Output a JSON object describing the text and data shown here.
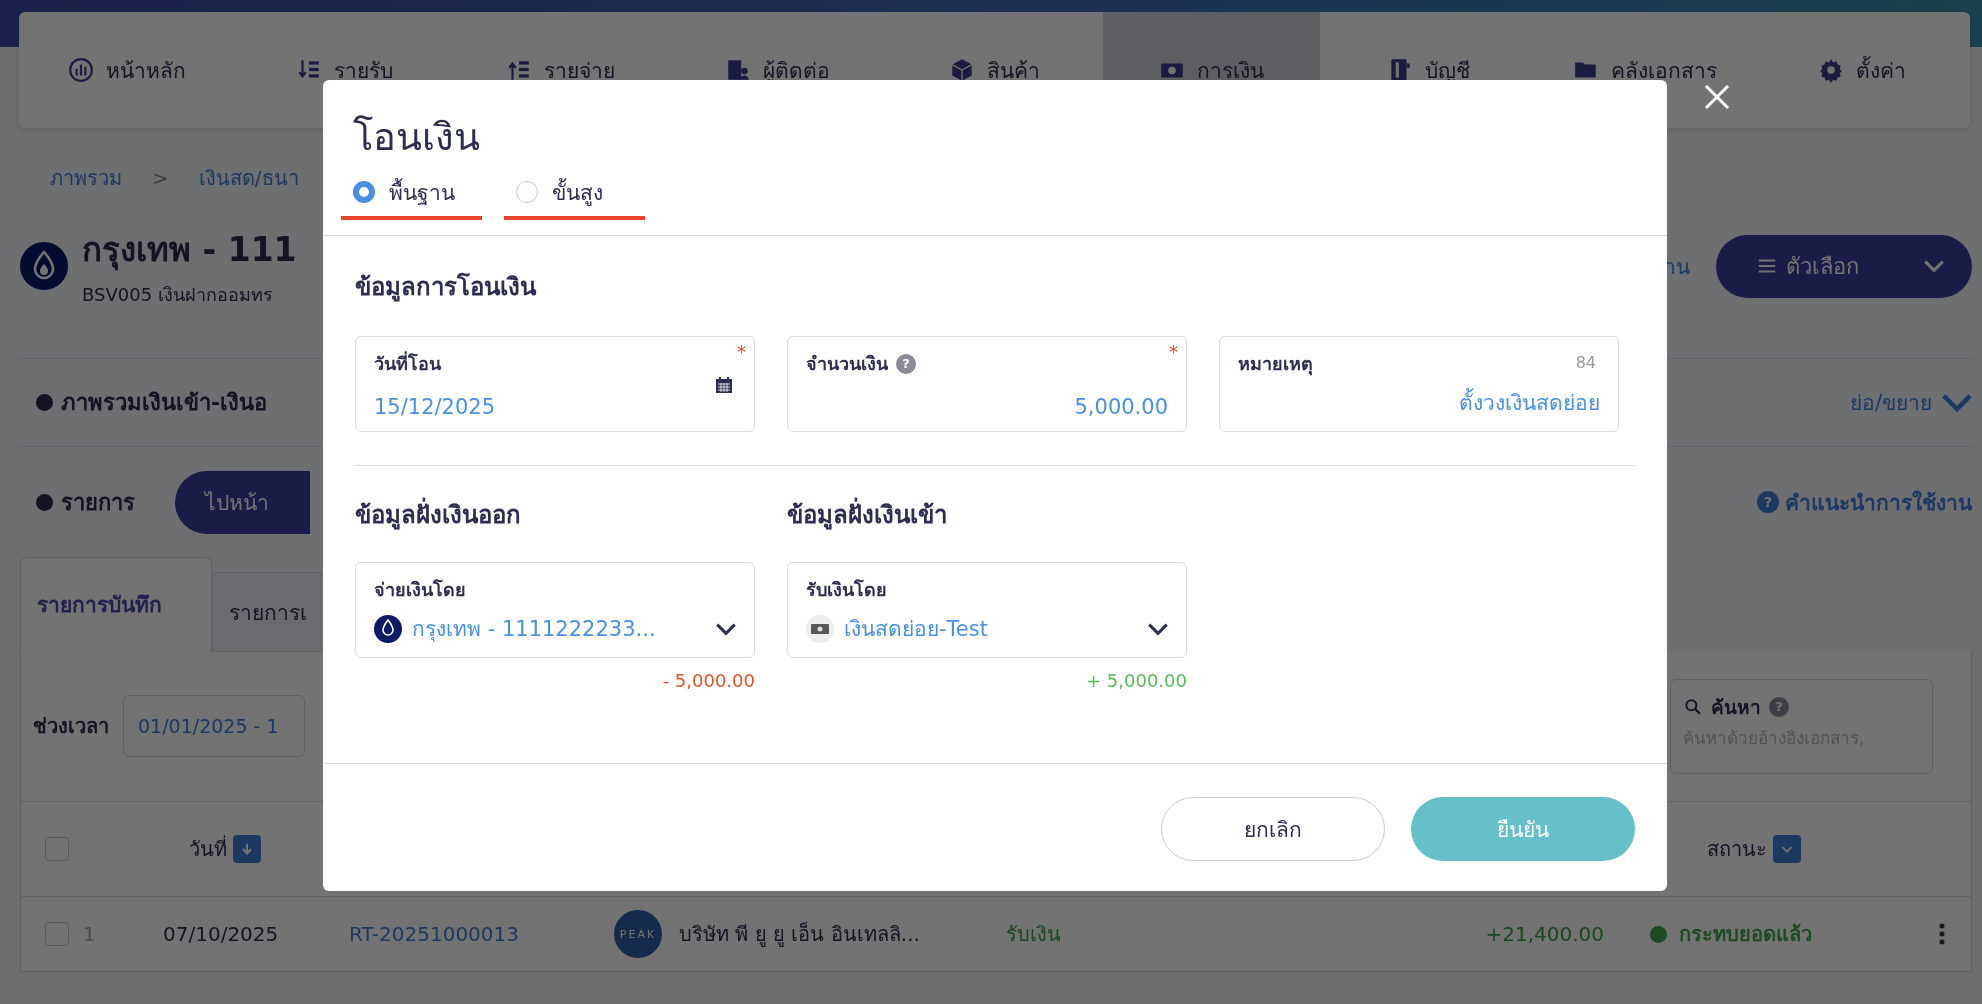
{
  "nav": [
    {
      "label": "หน้าหลัก",
      "selected": false
    },
    {
      "label": "รายรับ",
      "selected": false
    },
    {
      "label": "รายจ่าย",
      "selected": false
    },
    {
      "label": "ผู้ติดต่อ",
      "selected": false
    },
    {
      "label": "สินค้า",
      "selected": false
    },
    {
      "label": "การเงิน",
      "selected": true
    },
    {
      "label": "บัญชี",
      "selected": false
    },
    {
      "label": "คลังเอกสาร",
      "selected": false
    },
    {
      "label": "ตั้งค่า",
      "selected": false
    }
  ],
  "breadcrumb": {
    "items": [
      "ภาพรวม",
      "เงินสด/ธนา"
    ],
    "separator": ">"
  },
  "account": {
    "title": "กรุงเทพ - 111",
    "subtitle": "BSV005 เงินฝากออมทร",
    "right_text": "าน",
    "options_button": "ตัวเลือก"
  },
  "overview": {
    "title": "ภาพรวมเงินเข้า-เงินอ",
    "toggle": "ย่อ/ขยาย"
  },
  "list": {
    "title": "รายการ",
    "button": "ไปหน้า",
    "help_mark": "?",
    "help": "คำแนะนำการใช้งาน"
  },
  "tabs": [
    {
      "label": "รายการบันทึก",
      "selected": true
    },
    {
      "label": "รายการเ",
      "selected": false
    }
  ],
  "filter": {
    "label": "ช่วงเวลา",
    "value": "01/01/2025 - 1",
    "search_label": "ค้นหา",
    "search_help": "?",
    "search_placeholder": "ค้นหาด้วยอ้างอิงเอกสาร,"
  },
  "table": {
    "all_checked": false,
    "columns": [
      "วันที่",
      "สถานะ"
    ],
    "rows": [
      {
        "checked": false,
        "index": "1",
        "date": "07/10/2025",
        "doc": "RT-20251000013",
        "avatar": "PEAK",
        "contact": "บริษัท พี ยู ยู เอ็น อินเทลลิ...",
        "type": "รับเงิน",
        "amount": "+21,400.00",
        "status": "กระทบยอดแล้ว"
      }
    ]
  },
  "modal": {
    "title": "โอนเงิน",
    "modes": [
      {
        "label": "พื้นฐาน",
        "selected": true
      },
      {
        "label": "ขั้นสูง",
        "selected": false
      }
    ],
    "section": "ข้อมูลการโอนเงิน",
    "fields": [
      {
        "kind": "date",
        "label": "วันที่โอน",
        "value": "15/12/2025",
        "required_mark": "*"
      },
      {
        "kind": "amount",
        "label": "จำนวนเงิน",
        "help": "?",
        "value": "5,000.00",
        "required_mark": "*"
      },
      {
        "kind": "note",
        "label": "หมายเหตุ",
        "counter": "84",
        "value": "ตั้งวงเงินสดย่อย"
      }
    ],
    "sides": [
      {
        "kind": "outgoing",
        "title": "ข้อมูลฝั่งเงินออก",
        "label": "จ่ายเงินโดย",
        "value": "กรุงเทพ - 1111222233...",
        "amount": "- 5,000.00"
      },
      {
        "kind": "incoming",
        "title": "ข้อมูลฝั่งเงินเข้า",
        "label": "รับเงินโดย",
        "value": "เงินสดย่อย-Test",
        "amount": "+ 5,000.00"
      }
    ],
    "buttons": [
      {
        "label": "ยกเลิก",
        "kind": "secondary"
      },
      {
        "label": "ยืนยัน",
        "kind": "primary"
      }
    ]
  }
}
